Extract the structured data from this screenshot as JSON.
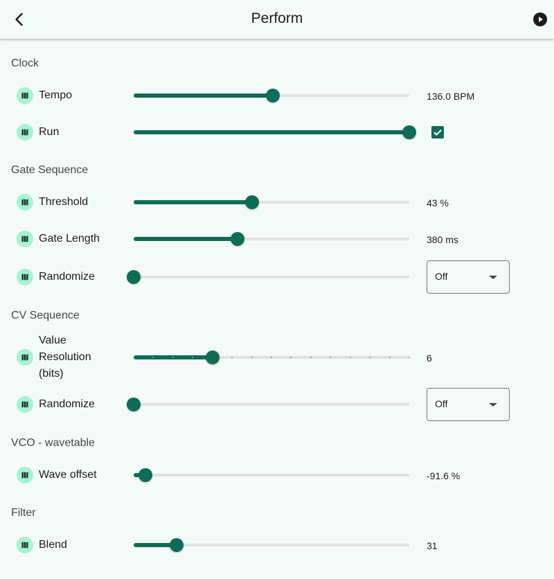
{
  "appbar": {
    "title": "Perform",
    "back_icon": "chevron-left-icon",
    "play_icon": "play-circle-icon"
  },
  "colors": {
    "accent": "#106b58",
    "icon_bg": "#a6f2d5",
    "track_inactive": "#dfe4e1",
    "background": "#f4faf7"
  },
  "sections": [
    {
      "title": "Clock",
      "params": [
        {
          "label": "Tempo",
          "icon": "map-icon",
          "control": "slider",
          "fraction": 0.505,
          "value_text": "136.0 BPM"
        },
        {
          "label": "Run",
          "icon": "map-icon",
          "control": "slider-checkbox",
          "fraction": 1.0,
          "checked": true
        }
      ]
    },
    {
      "title": "Gate Sequence",
      "params": [
        {
          "label": "Threshold",
          "icon": "map-icon",
          "control": "slider",
          "fraction": 0.43,
          "value_text": "43 %"
        },
        {
          "label": "Gate Length",
          "icon": "map-icon",
          "control": "slider",
          "fraction": 0.378,
          "value_text": "380 ms"
        },
        {
          "label": "Randomize",
          "icon": "map-icon",
          "control": "slider-dropdown",
          "fraction": 0.0,
          "dropdown_value": "Off"
        }
      ]
    },
    {
      "title": "CV Sequence",
      "params": [
        {
          "label": "Value Resolution (bits)",
          "icon": "map-icon",
          "control": "slider-discrete",
          "fraction": 0.2857,
          "divisions": 14,
          "value_text": "6"
        },
        {
          "label": "Randomize",
          "icon": "map-icon",
          "control": "slider-dropdown",
          "fraction": 0.0,
          "dropdown_value": "Off"
        }
      ]
    },
    {
      "title": "VCO - wavetable",
      "params": [
        {
          "label": "Wave offset",
          "icon": "map-icon",
          "control": "slider",
          "fraction": 0.042,
          "value_text": "-91.6 %"
        }
      ]
    },
    {
      "title": "Filter",
      "params": [
        {
          "label": "Blend",
          "icon": "map-icon",
          "control": "slider",
          "fraction": 0.156,
          "value_text": "31"
        }
      ]
    }
  ]
}
